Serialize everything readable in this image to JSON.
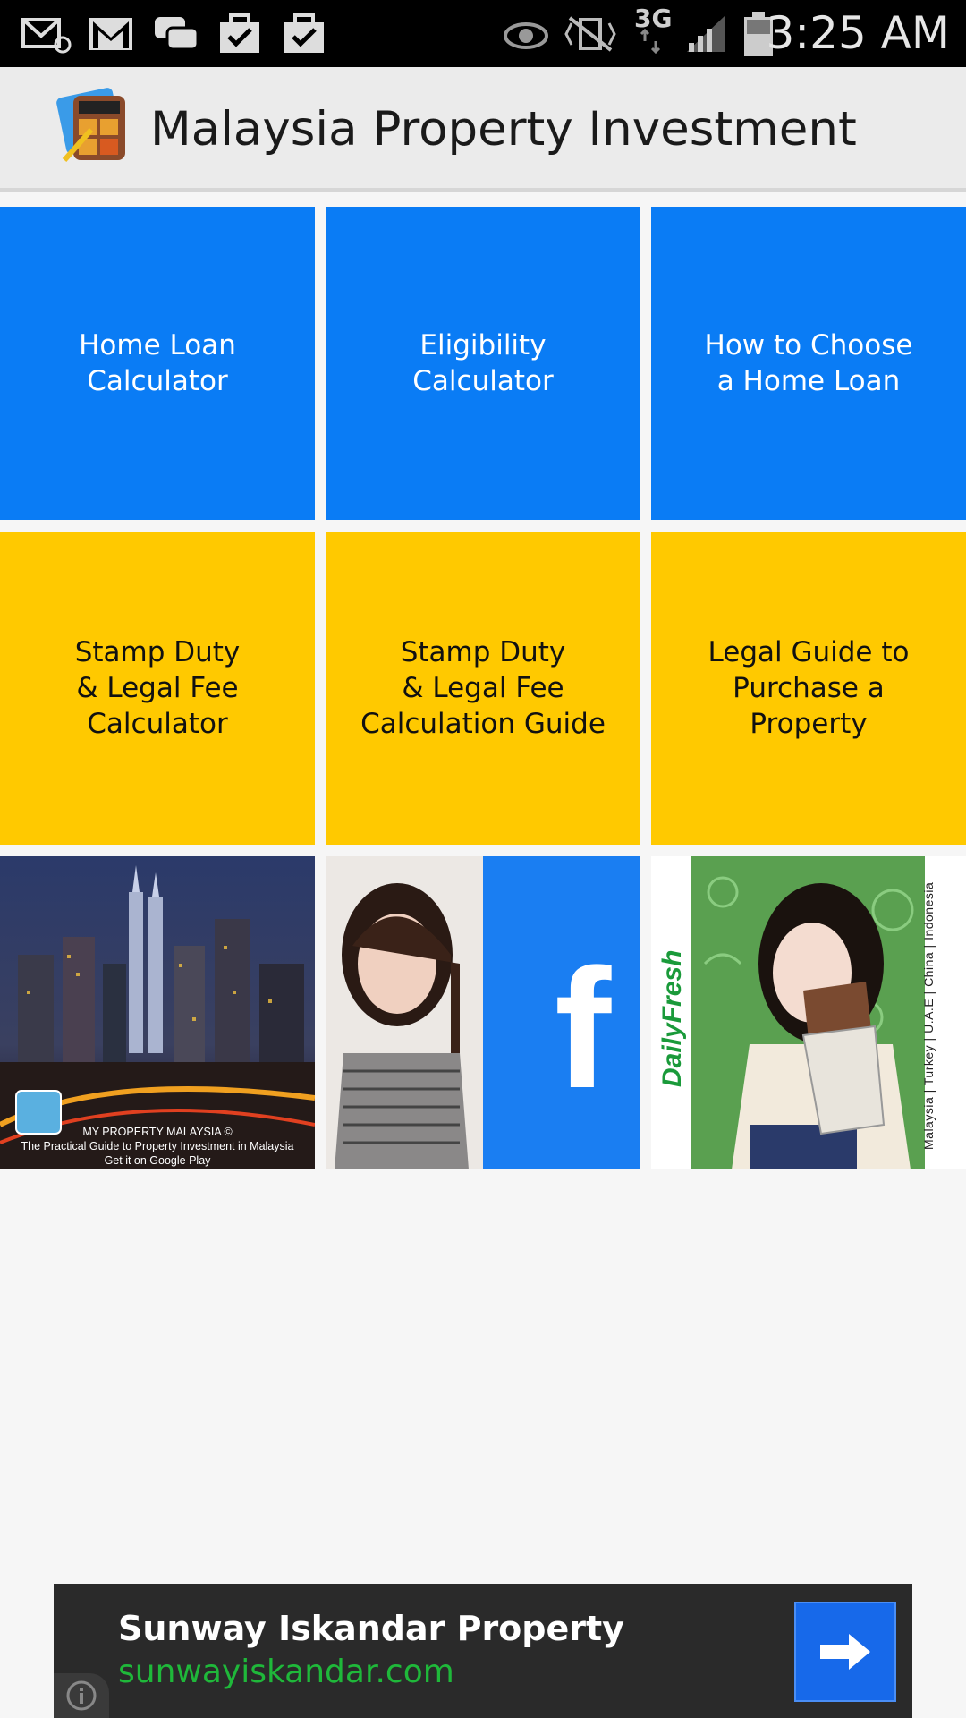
{
  "status_bar": {
    "time": "3:25 AM",
    "network": "3G",
    "icons": [
      "email-at-icon",
      "gmail-icon",
      "chat-bubbles-icon",
      "task-check-icon",
      "task-check-icon",
      "eye-icon",
      "vibrate-mute-icon",
      "signal-icon",
      "battery-icon"
    ]
  },
  "app_bar": {
    "title": "Malaysia Property Investment",
    "logo": "calculator-app-icon"
  },
  "tiles": [
    {
      "label": "Home Loan\nCalculator",
      "color": "#0a7cf5"
    },
    {
      "label": "Eligibility\nCalculator",
      "color": "#0a7cf5"
    },
    {
      "label": "How to Choose\na Home Loan",
      "color": "#0a7cf5"
    },
    {
      "label": "Stamp Duty\n& Legal Fee\nCalculator",
      "color": "#ffc900"
    },
    {
      "label": "Stamp Duty\n& Legal Fee\nCalculation Guide",
      "color": "#ffc900"
    },
    {
      "label": "Legal Guide to\nPurchase a\nProperty",
      "color": "#ffc900"
    }
  ],
  "image_tiles": {
    "city": {
      "caption": "MY PROPERTY MALAYSIA ©\nThe Practical Guide to Property Investment in Malaysia\nGet it on Google Play"
    },
    "facebook": {
      "letter": "f"
    },
    "dailyfresh": {
      "logo": "DailyFresh",
      "countries": "Malaysia | Turkey | U.A.E | China | Indonesia"
    }
  },
  "ad": {
    "title": "Sunway Iskandar Property",
    "url": "sunwayiskandar.com"
  }
}
